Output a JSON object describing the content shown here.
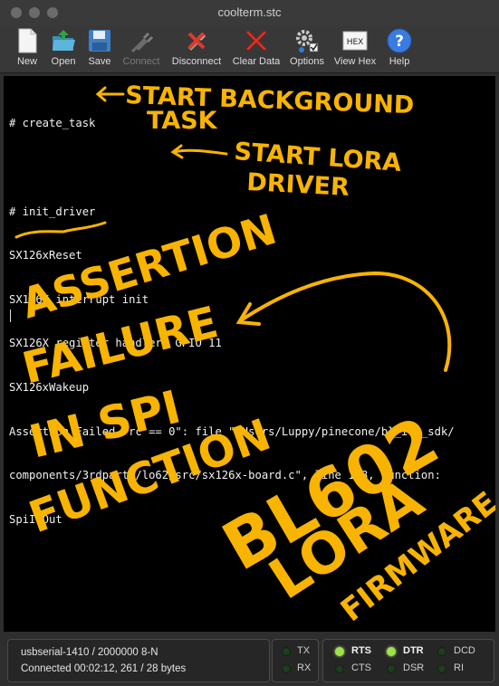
{
  "window": {
    "title": "coolterm.stc"
  },
  "toolbar": {
    "items": [
      {
        "label": "New",
        "icon": "document-icon",
        "enabled": true
      },
      {
        "label": "Open",
        "icon": "folder-open-icon",
        "enabled": true
      },
      {
        "label": "Save",
        "icon": "floppy-disk-icon",
        "enabled": true
      },
      {
        "label": "Connect",
        "icon": "usb-plug-icon",
        "enabled": false
      },
      {
        "label": "Disconnect",
        "icon": "unplug-icon",
        "enabled": true
      },
      {
        "label": "Clear Data",
        "icon": "red-x-icon",
        "enabled": true
      },
      {
        "label": "Options",
        "icon": "gear-icon",
        "enabled": true
      },
      {
        "label": "View Hex",
        "icon": "hex-icon",
        "enabled": true
      },
      {
        "label": "Help",
        "icon": "help-icon",
        "enabled": true
      }
    ],
    "hex_icon_text": "HEX"
  },
  "terminal": {
    "lines": [
      "# create_task",
      "",
      "# init_driver",
      "SX126xReset",
      "SX126X interrupt init",
      "SX126X register handler: GPIO 11",
      "SX126xWakeup",
      "Assertion Failed \"rc == 0\": file \"/Users/Luppy/pinecone/bl_iot_sdk/",
      "components/3rdparty/lo62/src/sx126x-board.c\", line 158, function:",
      "SpiInOut"
    ]
  },
  "annotations": {
    "start_background_task": [
      "START BACKGROUND",
      "TASK"
    ],
    "start_lora_driver": [
      "START LORA",
      "DRIVER"
    ],
    "assertion_failure": [
      "ASSERTION",
      "FAILURE",
      "IN SPI",
      "FUNCTION"
    ],
    "firmware": [
      "BL602",
      "LORA",
      "FIRMWARE"
    ],
    "color": "#f8b400"
  },
  "status": {
    "port_line": "usbserial-1410 / 2000000 8-N",
    "connection_line": "Connected 00:02:12, 261 / 28 bytes"
  },
  "leds": {
    "tx": {
      "label": "TX",
      "on": false
    },
    "rx": {
      "label": "RX",
      "on": false
    },
    "rts": {
      "label": "RTS",
      "on": true
    },
    "cts": {
      "label": "CTS",
      "on": false
    },
    "dtr": {
      "label": "DTR",
      "on": true
    },
    "dsr": {
      "label": "DSR",
      "on": false
    },
    "dcd": {
      "label": "DCD",
      "on": false
    },
    "ri": {
      "label": "RI",
      "on": false
    }
  }
}
